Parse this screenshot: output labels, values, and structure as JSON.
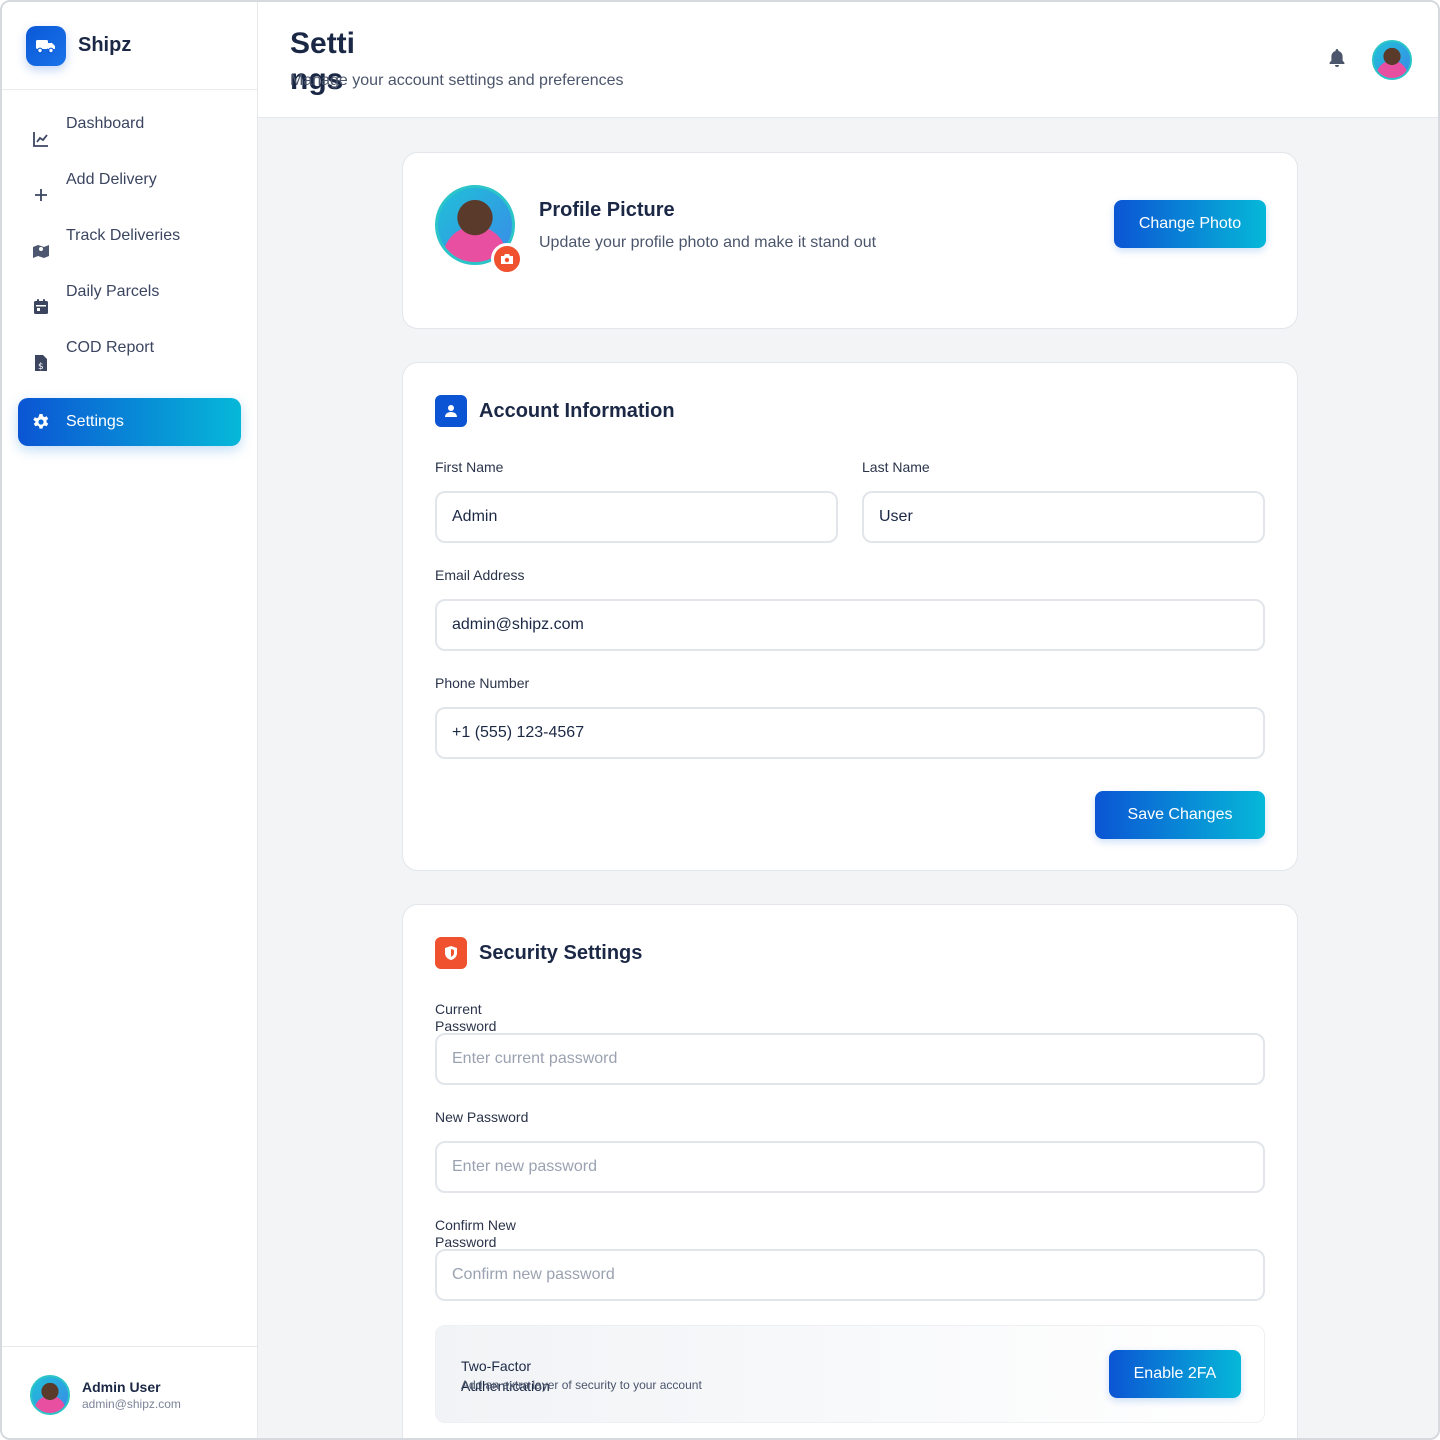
{
  "app": {
    "name": "Shipz"
  },
  "sidebar": {
    "items": [
      {
        "label": "Dashboard",
        "icon": "chart-line-icon"
      },
      {
        "label": "Add Delivery",
        "icon": "plus-icon"
      },
      {
        "label": "Track Deliveries",
        "icon": "map-icon"
      },
      {
        "label": "Daily Parcels",
        "icon": "calendar-icon"
      },
      {
        "label": "COD Report",
        "icon": "invoice-dollar-icon"
      },
      {
        "label": "Settings",
        "icon": "gear-icon",
        "active": true
      }
    ],
    "user": {
      "name": "Admin User",
      "email": "admin@shipz.com"
    }
  },
  "header": {
    "title": "Settings",
    "subtitle": "Manage your account settings and preferences"
  },
  "profile": {
    "title": "Profile Picture",
    "description": "Update your profile photo and make it stand out",
    "change_photo_label": "Change Photo"
  },
  "account": {
    "title": "Account Information",
    "first_name_label": "First Name",
    "first_name_value": "Admin",
    "last_name_label": "Last Name",
    "last_name_value": "User",
    "email_label": "Email Address",
    "email_value": "admin@shipz.com",
    "phone_label": "Phone Number",
    "phone_value": "+1 (555) 123-4567",
    "save_label": "Save Changes"
  },
  "security": {
    "title": "Security Settings",
    "current_label": "Current Password",
    "current_placeholder": "Enter current password",
    "new_label": "New Password",
    "new_placeholder": "Enter new password",
    "confirm_label": "Confirm New Password",
    "confirm_placeholder": "Confirm new password",
    "twofa_title": "Two-Factor Authentication",
    "twofa_description": "Add an extra layer of security to your account",
    "twofa_button": "Enable 2FA"
  },
  "colors": {
    "primary": "#0b55d4",
    "accent": "#06b8d8",
    "security": "#f0512f"
  }
}
